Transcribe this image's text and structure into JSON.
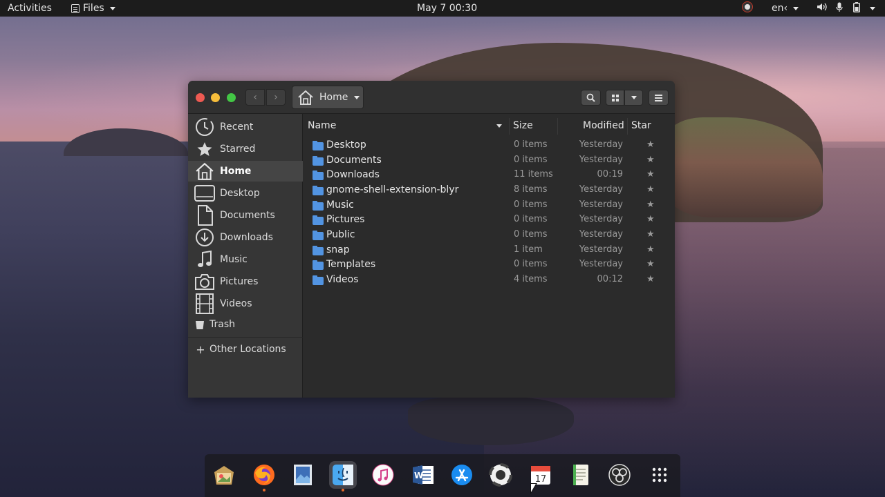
{
  "topbar": {
    "activities": "Activities",
    "app_menu": "Files",
    "clock": "May 7  00:30",
    "lang": "en‹"
  },
  "window": {
    "path_button": "Home"
  },
  "sidebar": {
    "items": [
      {
        "label": "Recent",
        "icon": "clock-icon"
      },
      {
        "label": "Starred",
        "icon": "star-icon"
      },
      {
        "label": "Home",
        "icon": "home-icon",
        "active": true
      },
      {
        "label": "Desktop",
        "icon": "desktop-icon"
      },
      {
        "label": "Documents",
        "icon": "document-icon"
      },
      {
        "label": "Downloads",
        "icon": "download-icon"
      },
      {
        "label": "Music",
        "icon": "music-icon"
      },
      {
        "label": "Pictures",
        "icon": "camera-icon"
      },
      {
        "label": "Videos",
        "icon": "film-icon"
      },
      {
        "label": "Trash",
        "icon": "trash-icon"
      }
    ],
    "other_locations": "Other Locations"
  },
  "list": {
    "columns": {
      "name": "Name",
      "size": "Size",
      "modified": "Modified",
      "star": "Star"
    },
    "rows": [
      {
        "name": "Desktop",
        "size": "0 items",
        "modified": "Yesterday"
      },
      {
        "name": "Documents",
        "size": "0 items",
        "modified": "Yesterday"
      },
      {
        "name": "Downloads",
        "size": "11 items",
        "modified": "00:19"
      },
      {
        "name": "gnome-shell-extension-blyr",
        "size": "8 items",
        "modified": "Yesterday"
      },
      {
        "name": "Music",
        "size": "0 items",
        "modified": "Yesterday"
      },
      {
        "name": "Pictures",
        "size": "0 items",
        "modified": "Yesterday"
      },
      {
        "name": "Public",
        "size": "0 items",
        "modified": "Yesterday"
      },
      {
        "name": "snap",
        "size": "1 item",
        "modified": "Yesterday"
      },
      {
        "name": "Templates",
        "size": "0 items",
        "modified": "Yesterday"
      },
      {
        "name": "Videos",
        "size": "4 items",
        "modified": "00:12"
      }
    ]
  },
  "dock": {
    "items": [
      "shotwell-icon",
      "firefox-icon",
      "image-viewer-icon",
      "files-icon",
      "itunes-icon",
      "word-icon",
      "app-store-icon",
      "help-icon",
      "calendar-icon",
      "text-editor-icon",
      "obs-icon",
      "show-apps-icon"
    ],
    "calendar_day": "17"
  },
  "colors": {
    "accent": "#5294e2",
    "close": "#ee5a52",
    "minimize": "#f6bd3b",
    "maximize": "#43c645"
  }
}
